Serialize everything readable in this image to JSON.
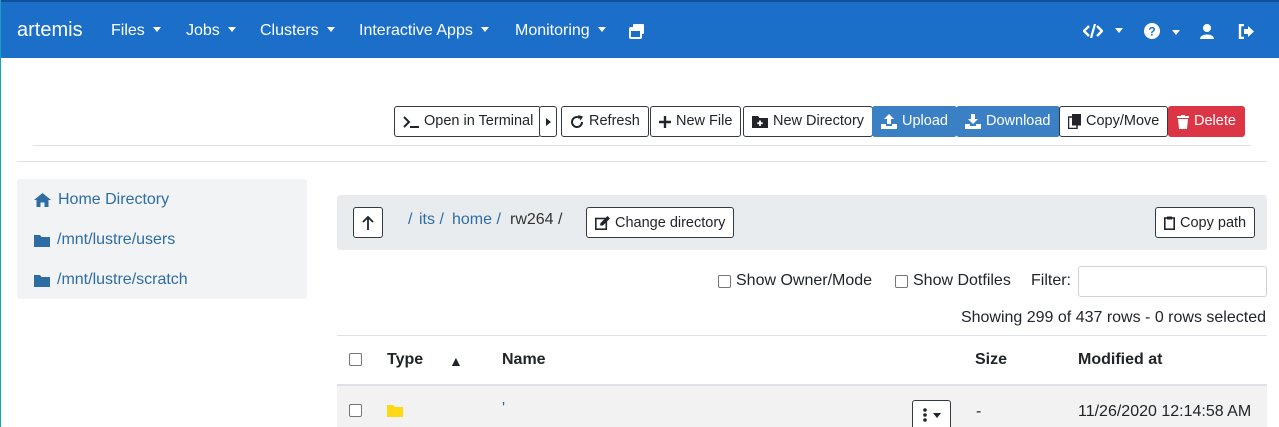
{
  "navbar": {
    "brand": "artemis",
    "menus": [
      "Files",
      "Jobs",
      "Clusters",
      "Interactive Apps",
      "Monitoring"
    ]
  },
  "toolbar": {
    "open_terminal": "Open in Terminal",
    "refresh": "Refresh",
    "new_file": "New File",
    "new_directory": "New Directory",
    "upload": "Upload",
    "download": "Download",
    "copy_move": "Copy/Move",
    "delete": "Delete"
  },
  "sidebar": {
    "items": [
      {
        "label": "Home Directory",
        "icon": "home-icon"
      },
      {
        "label": "/mnt/lustre/users",
        "icon": "folder-icon"
      },
      {
        "label": "/mnt/lustre/scratch",
        "icon": "folder-icon"
      }
    ]
  },
  "path": {
    "root": "/",
    "crumbs": [
      "its /",
      "home /"
    ],
    "current": "rw264 /",
    "change_directory": "Change directory",
    "copy_path": "Copy path"
  },
  "filters": {
    "show_owner_mode": "Show Owner/Mode",
    "show_dotfiles": "Show Dotfiles",
    "filter_label": "Filter:",
    "filter_value": ""
  },
  "rows_info": "Showing 299 of 437 rows - 0 rows selected",
  "table": {
    "headers": {
      "type": "Type",
      "sort_indicator": "▲",
      "name": "Name",
      "size": "Size",
      "modified": "Modified at"
    },
    "rows": [
      {
        "type_icon": "folder-icon",
        "name": "'",
        "size": "-",
        "modified": "11/26/2020 12:14:58 AM"
      }
    ]
  },
  "colors": {
    "navbar": "#1b6fc8",
    "link": "#2e6da4",
    "primary": "#3b80c5",
    "danger": "#dc3545",
    "folder": "#ffd814"
  }
}
